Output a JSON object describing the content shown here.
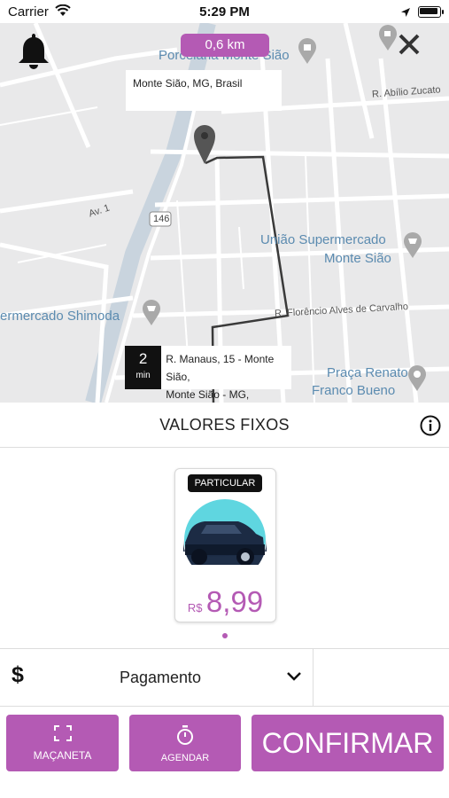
{
  "status_bar": {
    "carrier": "Carrier",
    "time": "5:29 PM"
  },
  "map": {
    "distance": "0,6 km",
    "origin_address": "Monte Sião, MG, Brasil",
    "destination": {
      "eta_value": "2",
      "eta_unit": "min",
      "address_line1": "R. Manaus, 15 - Monte Sião,",
      "address_line2": "Monte Sião - MG,"
    },
    "labels": {
      "porcelana": "Porcelana Monte Sião",
      "abilio": "R. Abílio Zucato",
      "av1": "Av. 1",
      "road146": "146",
      "uniao1": "União Supermercado",
      "uniao2": "Monte Sião",
      "shimoda": "ermercado Shimoda",
      "florencio": "R. Florêncio Alves de Carvalho",
      "praca1": "Praça Renato",
      "praca2": "Franco Bueno"
    }
  },
  "fixed_values": {
    "title": "VALORES FIXOS"
  },
  "vehicle_card": {
    "badge": "PARTICULAR",
    "currency": "R$",
    "price": "8,99"
  },
  "payment": {
    "icon_symbol": "$",
    "label": "Pagamento"
  },
  "actions": {
    "handle_label": "MAÇANETA",
    "schedule_label": "AGENDAR",
    "confirm_label": "CONFIRMAR"
  },
  "colors": {
    "accent": "#b45ab4",
    "map_bg": "#e9e9ea",
    "road": "#ffffff"
  }
}
